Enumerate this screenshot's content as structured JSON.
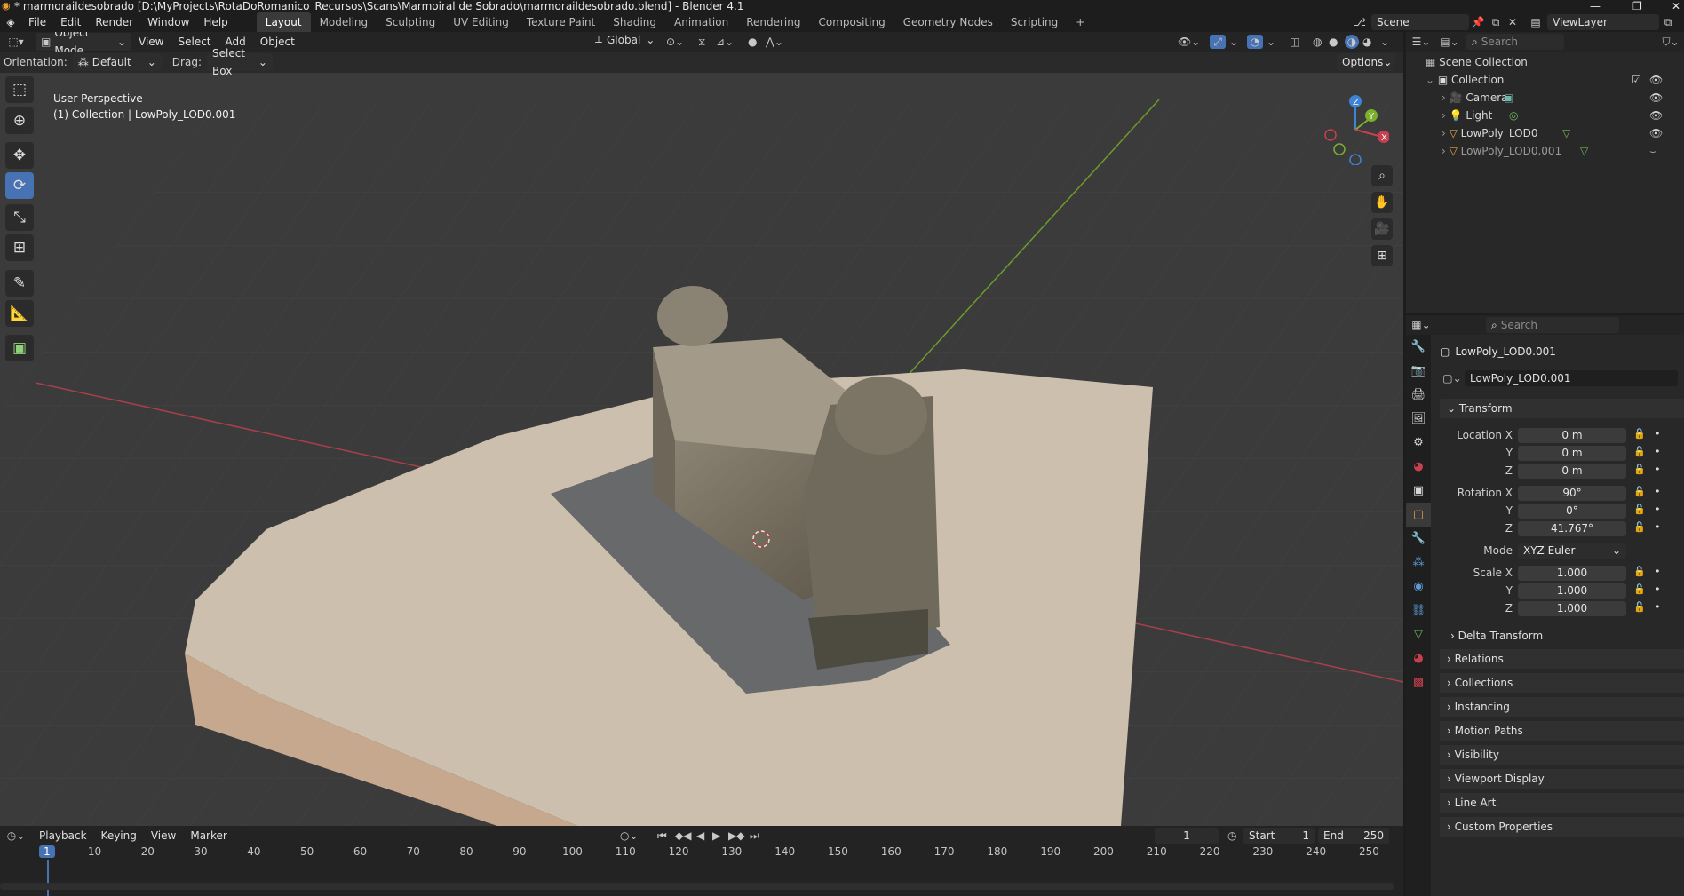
{
  "window": {
    "title": "* marmorail​desobrado [D:\\MyProjects\\RotaDoRomanico_Recursos\\Scans\\Marmoiral de Sobrado\\marmoraildesobrado.blend] - Blender 4.1"
  },
  "menus": [
    "File",
    "Edit",
    "Render",
    "Window",
    "Help"
  ],
  "workspaces": [
    "Layout",
    "Modeling",
    "Sculpting",
    "UV Editing",
    "Texture Paint",
    "Shading",
    "Animation",
    "Rendering",
    "Compositing",
    "Geometry Nodes",
    "Scripting"
  ],
  "scene": {
    "name": "Scene",
    "view_layer": "ViewLayer"
  },
  "viewport": {
    "mode": "Object Mode",
    "menus": [
      "View",
      "Select",
      "Add",
      "Object"
    ],
    "transform_orientation": "Global",
    "orientation_label": "Orientation:",
    "orientation_value": "Default",
    "drag_label": "Drag:",
    "drag_value": "Select Box",
    "options_label": "Options",
    "overlay_title": "User Perspective",
    "overlay_sub": "(1) Collection | LowPoly_LOD0.001",
    "gizmo": {
      "z": "Z",
      "y": "Y",
      "x": "X"
    }
  },
  "timeline": {
    "menus": [
      "Playback",
      "Keying",
      "View",
      "Marker"
    ],
    "current_frame": "1",
    "start_label": "Start",
    "start": "1",
    "end_label": "End",
    "end": "250",
    "ticks": [
      "1",
      "10",
      "20",
      "30",
      "40",
      "50",
      "60",
      "70",
      "80",
      "90",
      "100",
      "110",
      "120",
      "130",
      "140",
      "150",
      "160",
      "170",
      "180",
      "190",
      "200",
      "210",
      "220",
      "230",
      "240",
      "250"
    ]
  },
  "outliner": {
    "search_placeholder": "Search",
    "root": "Scene Collection",
    "collection": "Collection",
    "items": [
      "Camera",
      "Light",
      "LowPoly_LOD0",
      "LowPoly_LOD0.001"
    ]
  },
  "properties": {
    "search_placeholder": "Search",
    "object_name": "LowPoly_LOD0.001",
    "datablock_name": "LowPoly_LOD0.001",
    "transform_header": "Transform",
    "location": {
      "label_x": "Location X",
      "label_y": "Y",
      "label_z": "Z",
      "x": "0 m",
      "y": "0 m",
      "z": "0 m"
    },
    "rotation": {
      "label_x": "Rotation X",
      "label_y": "Y",
      "label_z": "Z",
      "x": "90°",
      "y": "0°",
      "z": "41.767°"
    },
    "mode_label": "Mode",
    "mode_value": "XYZ Euler",
    "scale": {
      "label_x": "Scale X",
      "label_y": "Y",
      "label_z": "Z",
      "x": "1.000",
      "y": "1.000",
      "z": "1.000"
    },
    "delta_transform": "Delta Transform",
    "panels": [
      "Relations",
      "Collections",
      "Instancing",
      "Motion Paths",
      "Visibility",
      "Viewport Display",
      "Line Art",
      "Custom Properties"
    ]
  },
  "colors": {
    "accent": "#4772b3",
    "x_axis": "#c8404f",
    "y_axis": "#7ab02c",
    "z_axis": "#3f83d6"
  }
}
